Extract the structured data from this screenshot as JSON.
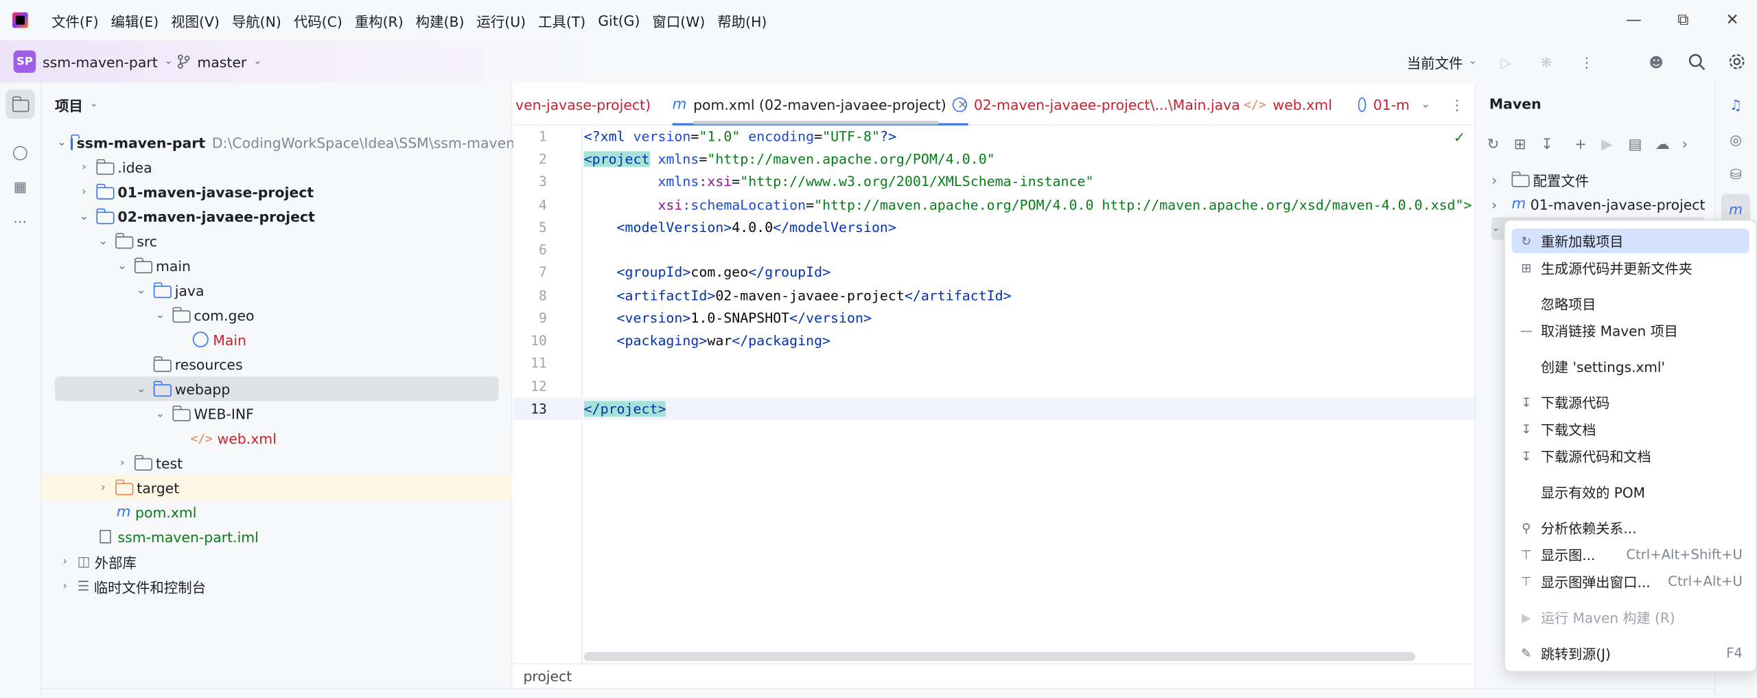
{
  "menu": [
    "文件(F)",
    "编辑(E)",
    "视图(V)",
    "导航(N)",
    "代码(C)",
    "重构(R)",
    "构建(B)",
    "运行(U)",
    "工具(T)",
    "Git(G)",
    "窗口(W)",
    "帮助(H)"
  ],
  "toolbar": {
    "project_badge": "SP",
    "project_name": "ssm-maven-part",
    "branch": "master",
    "run_config": "当前文件"
  },
  "project": {
    "header": "项目",
    "rows": [
      {
        "label": "ssm-maven-part",
        "path": "D:\\CodingWorkSpace\\Idea\\SSM\\ssm-maven-part"
      },
      {
        "label": ".idea"
      },
      {
        "label": "01-maven-javase-project"
      },
      {
        "label": "02-maven-javaee-project"
      },
      {
        "label": "src"
      },
      {
        "label": "main"
      },
      {
        "label": "java"
      },
      {
        "label": "com.geo"
      },
      {
        "label": "Main"
      },
      {
        "label": "resources"
      },
      {
        "label": "webapp"
      },
      {
        "label": "WEB-INF"
      },
      {
        "label": "web.xml"
      },
      {
        "label": "test"
      },
      {
        "label": "target"
      },
      {
        "label": "pom.xml"
      },
      {
        "label": "ssm-maven-part.iml"
      },
      {
        "label": "外部库"
      },
      {
        "label": "临时文件和控制台"
      }
    ]
  },
  "tabs": [
    {
      "label": "ven-javase-project)"
    },
    {
      "label": "pom.xml (02-maven-javaee-project)",
      "active": true
    },
    {
      "label": "02-maven-javaee-project\\...\\Main.java"
    },
    {
      "label": "web.xml"
    },
    {
      "label": "01-m"
    }
  ],
  "editor": {
    "line_numbers": [
      "1",
      "2",
      "3",
      "4",
      "5",
      "6",
      "7",
      "8",
      "9",
      "10",
      "11",
      "12",
      "13"
    ],
    "l1": {
      "a": "<?xml ",
      "b": "version",
      "c": "=",
      "d": "\"1.0\"",
      "e": " encoding",
      "f": "=",
      "g": "\"UTF-8\"",
      "h": "?>"
    },
    "l2": {
      "a": "<project",
      "b": " xmlns",
      "c": "=",
      "d": "\"http://maven.apache.org/POM/4.0.0\""
    },
    "l3": {
      "a": "         xmlns",
      "b": ":xsi",
      "c": "=",
      "d": "\"http://www.w3.org/2001/XMLSchema-instance\""
    },
    "l4": {
      "a": "         xsi",
      "b": ":schemaLocation",
      "c": "=",
      "d": "\"http://maven.apache.org/POM/4.0.0 http://maven.apache.org/xsd/maven-4.0.0.xsd\">"
    },
    "l5": {
      "a": "    <modelVersion>",
      "b": "4.0.0",
      "c": "</modelVersion>"
    },
    "l7": {
      "a": "    <groupId>",
      "b": "com.geo",
      "c": "</groupId>"
    },
    "l8": {
      "a": "    <artifactId>",
      "b": "02-maven-javaee-project",
      "c": "</artifactId>"
    },
    "l9": {
      "a": "    <version>",
      "b": "1.0-SNAPSHOT",
      "c": "</version>"
    },
    "l10": {
      "a": "    <packaging>",
      "b": "war",
      "c": "</packaging>"
    },
    "l13": {
      "a": "</project>"
    },
    "breadcrumb": "project"
  },
  "maven": {
    "title": "Maven",
    "items": [
      {
        "label": "配置文件"
      },
      {
        "label": "01-maven-javase-project"
      }
    ]
  },
  "context_menu": [
    {
      "label": "重新加载项目",
      "icon": "reload-icon"
    },
    {
      "label": "生成源代码并更新文件夹",
      "icon": "generate-sources-icon"
    },
    {
      "label": "忽略项目"
    },
    {
      "label": "取消链接 Maven 项目",
      "icon": "unlink-icon"
    },
    {
      "label": "创建 'settings.xml'"
    },
    {
      "label": "下载源代码",
      "icon": "download-icon"
    },
    {
      "label": "下载文档",
      "icon": "download-icon"
    },
    {
      "label": "下载源代码和文档",
      "icon": "download-icon"
    },
    {
      "label": "显示有效的 POM"
    },
    {
      "label": "分析依赖关系...",
      "icon": "dependency-icon"
    },
    {
      "label": "显示图...",
      "shortcut": "Ctrl+Alt+Shift+U",
      "icon": "diagram-icon"
    },
    {
      "label": "显示图弹出窗口...",
      "shortcut": "Ctrl+Alt+U",
      "icon": "diagram-icon"
    },
    {
      "label": "运行 Maven 构建 (R)",
      "disabled": true,
      "icon": "run-icon"
    },
    {
      "label": "跳转到源(J)",
      "shortcut": "F4",
      "icon": "edit-icon"
    }
  ],
  "colors": {
    "accent": "#3574f0",
    "selection": "#d5e1ff",
    "selected_row": "#dfe1e5",
    "excluded_row": "#fdf6e3",
    "hover_menu": "#d4e2ff"
  }
}
